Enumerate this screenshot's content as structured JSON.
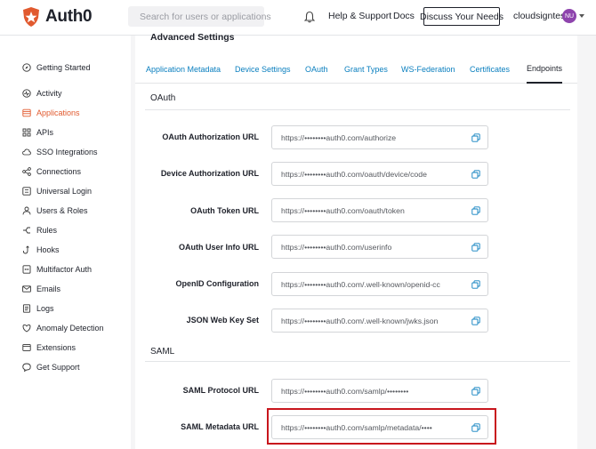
{
  "header": {
    "logo_text": "Auth0",
    "search_placeholder": "Search for users or applications",
    "help_label": "Help & Support",
    "docs_label": "Docs",
    "discuss_label": "Discuss Your Needs",
    "tenant_name": "cloudsigntest",
    "avatar_initials": "NU"
  },
  "sidebar": {
    "items": [
      {
        "label": "Getting Started",
        "icon": "compass-icon"
      },
      {
        "label": "Activity",
        "icon": "activity-icon"
      },
      {
        "label": "Applications",
        "icon": "applications-icon",
        "active": true
      },
      {
        "label": "APIs",
        "icon": "api-icon"
      },
      {
        "label": "SSO Integrations",
        "icon": "sso-icon"
      },
      {
        "label": "Connections",
        "icon": "connections-icon"
      },
      {
        "label": "Universal Login",
        "icon": "login-icon"
      },
      {
        "label": "Users & Roles",
        "icon": "users-icon"
      },
      {
        "label": "Rules",
        "icon": "rules-icon"
      },
      {
        "label": "Hooks",
        "icon": "hooks-icon"
      },
      {
        "label": "Multifactor Auth",
        "icon": "mfa-icon"
      },
      {
        "label": "Emails",
        "icon": "email-icon"
      },
      {
        "label": "Logs",
        "icon": "logs-icon"
      },
      {
        "label": "Anomaly Detection",
        "icon": "anomaly-icon"
      },
      {
        "label": "Extensions",
        "icon": "extensions-icon"
      },
      {
        "label": "Get Support",
        "icon": "support-icon"
      }
    ]
  },
  "main": {
    "section_heading": "Advanced Settings",
    "tabs": [
      {
        "label": "Application Metadata"
      },
      {
        "label": "Device Settings"
      },
      {
        "label": "OAuth"
      },
      {
        "label": "Grant Types"
      },
      {
        "label": "WS-Federation"
      },
      {
        "label": "Certificates"
      },
      {
        "label": "Endpoints",
        "active": true
      }
    ],
    "oauth": {
      "title": "OAuth",
      "fields": [
        {
          "label": "OAuth Authorization URL",
          "value": "https://••••••••auth0.com/authorize"
        },
        {
          "label": "Device Authorization URL",
          "value": "https://••••••••auth0.com/oauth/device/code"
        },
        {
          "label": "OAuth Token URL",
          "value": "https://••••••••auth0.com/oauth/token"
        },
        {
          "label": "OAuth User Info URL",
          "value": "https://••••••••auth0.com/userinfo"
        },
        {
          "label": "OpenID Configuration",
          "value": "https://••••••••auth0.com/.well-known/openid-cc"
        },
        {
          "label": "JSON Web Key Set",
          "value": "https://••••••••auth0.com/.well-known/jwks.json"
        }
      ]
    },
    "saml": {
      "title": "SAML",
      "fields": [
        {
          "label": "SAML Protocol URL",
          "value": "https://••••••••auth0.com/samlp/••••••••"
        },
        {
          "label": "SAML Metadata URL",
          "value": "https://••••••••auth0.com/samlp/metadata/••••"
        }
      ]
    }
  },
  "colors": {
    "accent": "#e15a2f",
    "link": "#0a7fbf",
    "highlight": "#c8161d",
    "avatar": "#8e44ad"
  }
}
